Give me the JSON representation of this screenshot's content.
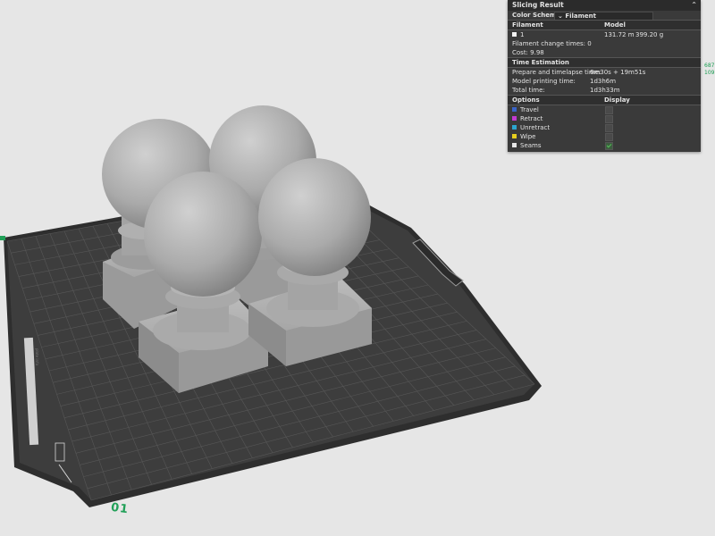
{
  "panel": {
    "title": "Slicing Result",
    "color_scheme_label": "Color Scheme",
    "color_scheme_value": "Filament",
    "filament_header": "Filament",
    "model_header": "Model",
    "filament_id": "1",
    "filament_length": "131.72 m",
    "filament_weight": "399.20 g",
    "change_times": "Filament change times: 0",
    "cost": "Cost: 9.98",
    "time_header": "Time Estimation",
    "prepare_label": "Prepare and timelapse time:",
    "prepare_value": "6m30s + 19m51s",
    "model_time_label": "Model printing time:",
    "model_time_value": "1d3h6m",
    "total_label": "Total time:",
    "total_value": "1d3h33m",
    "options_header": "Options",
    "display_header": "Display",
    "options": [
      {
        "label": "Travel",
        "color": "#3a64c8",
        "checked": false
      },
      {
        "label": "Retract",
        "color": "#c23ad0",
        "checked": false
      },
      {
        "label": "Unretract",
        "color": "#2ca6cf",
        "checked": false
      },
      {
        "label": "Wipe",
        "color": "#e6cf1e",
        "checked": false
      },
      {
        "label": "Seams",
        "color": "#e6e6e6",
        "checked": true
      }
    ]
  },
  "side_numbers": [
    "687",
    "109."
  ],
  "plate_number": "01",
  "colors": {
    "plate": "#3d3d3d",
    "grid": "#5a5a5a",
    "accent": "#21a058",
    "model": "#a8a8a8"
  }
}
